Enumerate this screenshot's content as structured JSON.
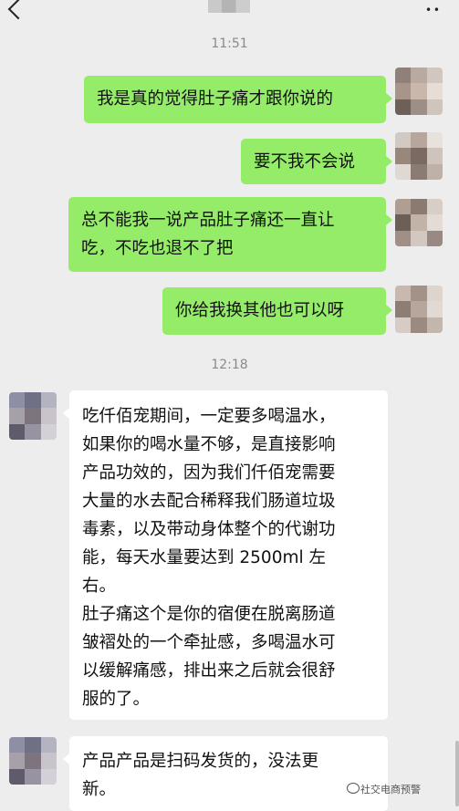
{
  "header": {
    "back_icon": "back-chevron-icon",
    "more_icon": "more-dots-icon",
    "more_label": "• •"
  },
  "timestamps": [
    "11:51",
    "12:18"
  ],
  "messages": [
    {
      "side": "out",
      "text": "我是真的觉得肚子痛才跟你说的"
    },
    {
      "side": "out",
      "text": "要不我不会说"
    },
    {
      "side": "out",
      "text": "总不能我一说产品肚子痛还一直让\n吃，不吃也退不了把"
    },
    {
      "side": "out",
      "text": "你给我换其他也可以呀"
    },
    {
      "side": "in",
      "text": "吃仟佰宠期间，一定要多喝温水，\n如果你的喝水量不够，是直接影响\n产品功效的，因为我们仟佰宠需要\n大量的水去配合稀释我们肠道垃圾\n毒素，以及带动身体整个的代谢功\n能，每天水量要达到 2500ml 左\n右。\n肚子痛这个是你的宿便在脱离肠道\n皱褶处的一个牵扯感，多喝温水可\n以缓解痛感，排出来之后就会很舒\n服的了。"
    },
    {
      "side": "in",
      "text": "产品产品是扫码发货的，没法更\n新。"
    }
  ],
  "watermark": {
    "text": "社交电商预警"
  },
  "colors": {
    "background": "#ededed",
    "outgoing_bubble": "#95ec69",
    "incoming_bubble": "#ffffff",
    "timestamp": "#8a8a8a"
  }
}
